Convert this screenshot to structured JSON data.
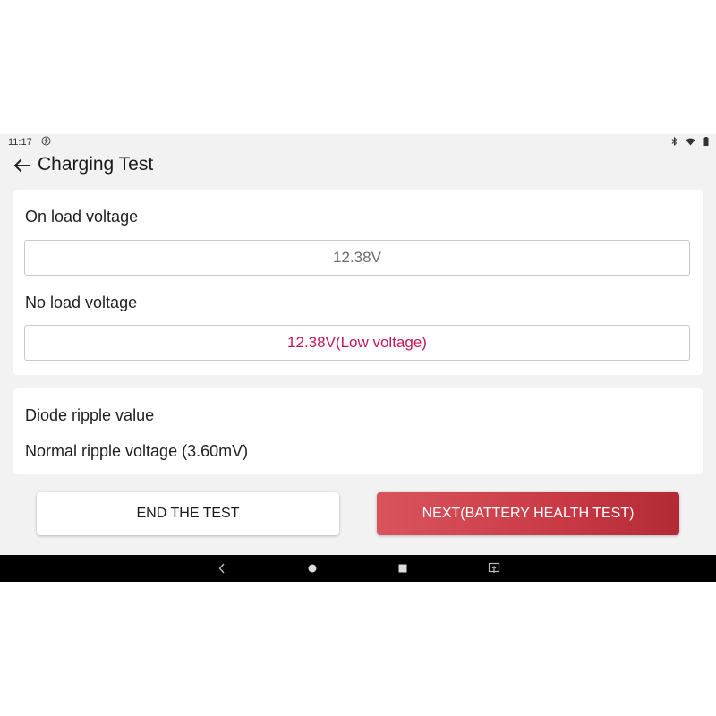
{
  "status_bar": {
    "time": "11:17",
    "notification_icon": "accessibility-icon",
    "right_icons": [
      "bluetooth-icon",
      "wifi-icon",
      "battery-icon"
    ]
  },
  "app_bar": {
    "back_icon": "arrow-left-icon",
    "title": "Charging Test"
  },
  "voltage_card": {
    "on_load_label": "On load voltage",
    "on_load_value": "12.38V",
    "no_load_label": "No load voltage",
    "no_load_value": "12.38V(Low voltage)"
  },
  "ripple_card": {
    "label": "Diode ripple value",
    "value": "Normal ripple voltage (3.60mV)"
  },
  "actions": {
    "end_label": "END THE TEST",
    "next_label": "NEXT(BATTERY HEALTH TEST)"
  },
  "nav_bar": {
    "icons": [
      "back-icon",
      "home-icon",
      "recents-icon",
      "screenshot-icon"
    ]
  },
  "colors": {
    "warning_text": "#c2185b",
    "primary_button": "#c93a45",
    "background": "#f2f2f2"
  }
}
